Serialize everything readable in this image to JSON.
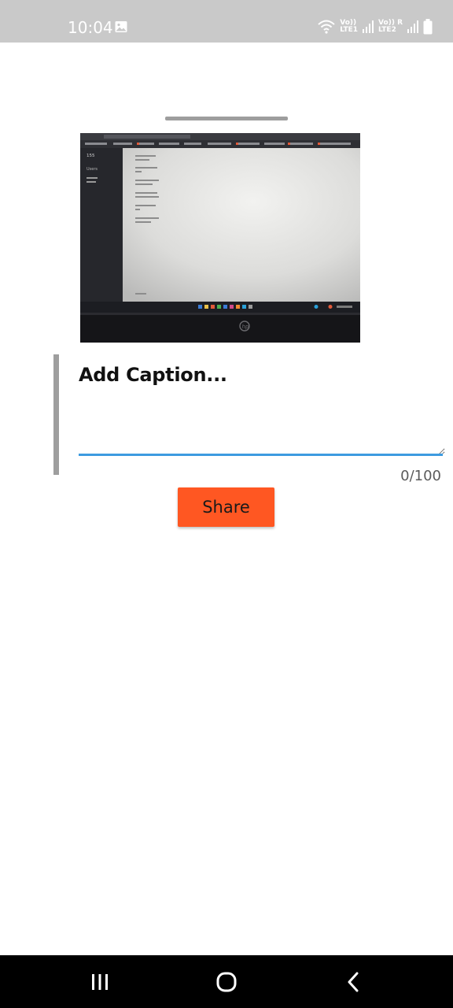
{
  "status_bar": {
    "time": "10:04",
    "sim1_label": "Vo))",
    "sim1_network": "LTE1",
    "sim2_label": "Vo)) R",
    "sim2_network": "LTE2",
    "icons": [
      "gallery-icon",
      "wifi-icon",
      "signal-icon",
      "battery-icon"
    ]
  },
  "caption": {
    "placeholder": "Add Caption...",
    "value": "",
    "counter": "0/100"
  },
  "share_button": {
    "label": "Share"
  },
  "photo": {
    "description_icon": "laptop-screen-photo",
    "sidebar_count": "155",
    "sidebar_label": "Users"
  },
  "nav_bar": {
    "icons": [
      "recent-apps-icon",
      "home-icon",
      "back-icon"
    ]
  },
  "colors": {
    "status_bar": "#c9c9c9",
    "accent_underline": "#3d9be0",
    "share_button": "#ff5722",
    "nav_bar": "#000000"
  }
}
